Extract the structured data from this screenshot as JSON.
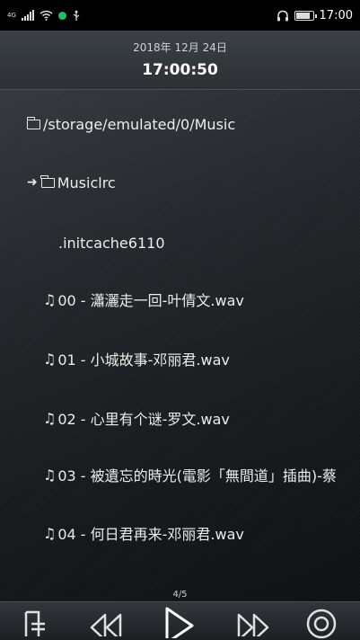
{
  "statusbar": {
    "network_label": "4G",
    "time": "17:00",
    "battery_level": 0.9
  },
  "header": {
    "date": "2018年 12月 24日",
    "time": "17:00:50"
  },
  "files": [
    {
      "type": "folder",
      "name": "/storage/emulated/0/Music"
    },
    {
      "type": "folder-current",
      "name": "Musiclrc"
    },
    {
      "type": "file",
      "name": ".initcache6110"
    },
    {
      "type": "audio",
      "name": "00 - 瀟灑走一回-叶倩文.wav"
    },
    {
      "type": "audio",
      "name": "01 - 小城故事-邓丽君.wav"
    },
    {
      "type": "audio",
      "name": "02 - 心里有个谜-罗文.wav"
    },
    {
      "type": "audio",
      "name": "03 - 被遺忘的時光(電影「無間道」插曲)-蔡"
    },
    {
      "type": "audio",
      "name": "04 - 何日君再来-邓丽君.wav"
    }
  ],
  "pager": "4/5",
  "controls": {
    "icons": [
      "playlist-icon",
      "rewind-icon",
      "play-icon",
      "fast-forward-icon",
      "settings-icon"
    ]
  }
}
